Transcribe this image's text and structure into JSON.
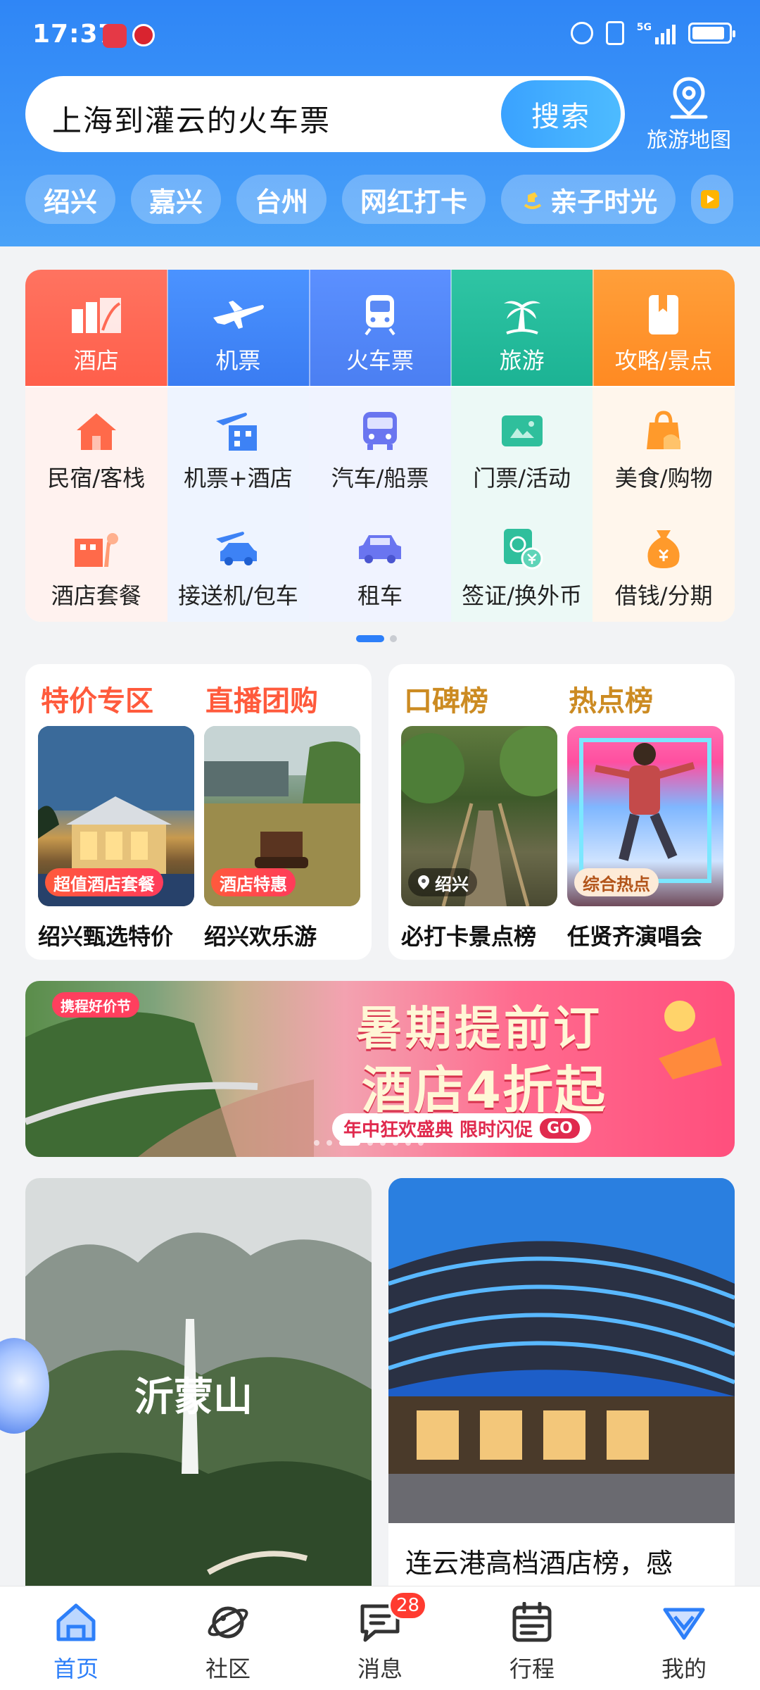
{
  "status_bar": {
    "time": "17:37",
    "network": "5G"
  },
  "search": {
    "query": "上海到灌云的火车票",
    "button": "搜索"
  },
  "map_entry": {
    "label": "旅游地图"
  },
  "chips": [
    "绍兴",
    "嘉兴",
    "台州",
    "网红打卡",
    "亲子时光"
  ],
  "grid": {
    "row1": [
      "酒店",
      "机票",
      "火车票",
      "旅游",
      "攻略/景点"
    ],
    "row2": [
      "民宿/客栈",
      "机票+酒店",
      "汽车/船票",
      "门票/活动",
      "美食/购物"
    ],
    "row3": [
      "酒店套餐",
      "接送机/包车",
      "租车",
      "签证/换外币",
      "借钱/分期"
    ]
  },
  "promo_left": {
    "title1": "特价专区",
    "title2": "直播团购",
    "badge1": "超值酒店套餐",
    "badge2": "酒店特惠",
    "caption1": "绍兴甄选特价",
    "caption2": "绍兴欢乐游"
  },
  "promo_right": {
    "title1": "口碑榜",
    "title2": "热点榜",
    "badge1": "绍兴",
    "badge2": "综合热点",
    "caption1": "必打卡景点榜",
    "caption2": "任贤齐演唱会"
  },
  "banner": {
    "tag": "携程好价节",
    "title_line1": "暑期提前订",
    "title_line2": "酒店4折起",
    "subtitle": "年中狂欢盛典 限时闪促",
    "go": "GO"
  },
  "feed": {
    "left_image_text": "沂蒙山",
    "right_caption": "连云港高档酒店榜，感"
  },
  "tabbar": {
    "tabs": [
      "首页",
      "社区",
      "消息",
      "行程",
      "我的"
    ],
    "message_badge": "28"
  },
  "colors": {
    "brand_blue": "#2d7ff9",
    "accent_red": "#ff5a3c"
  }
}
